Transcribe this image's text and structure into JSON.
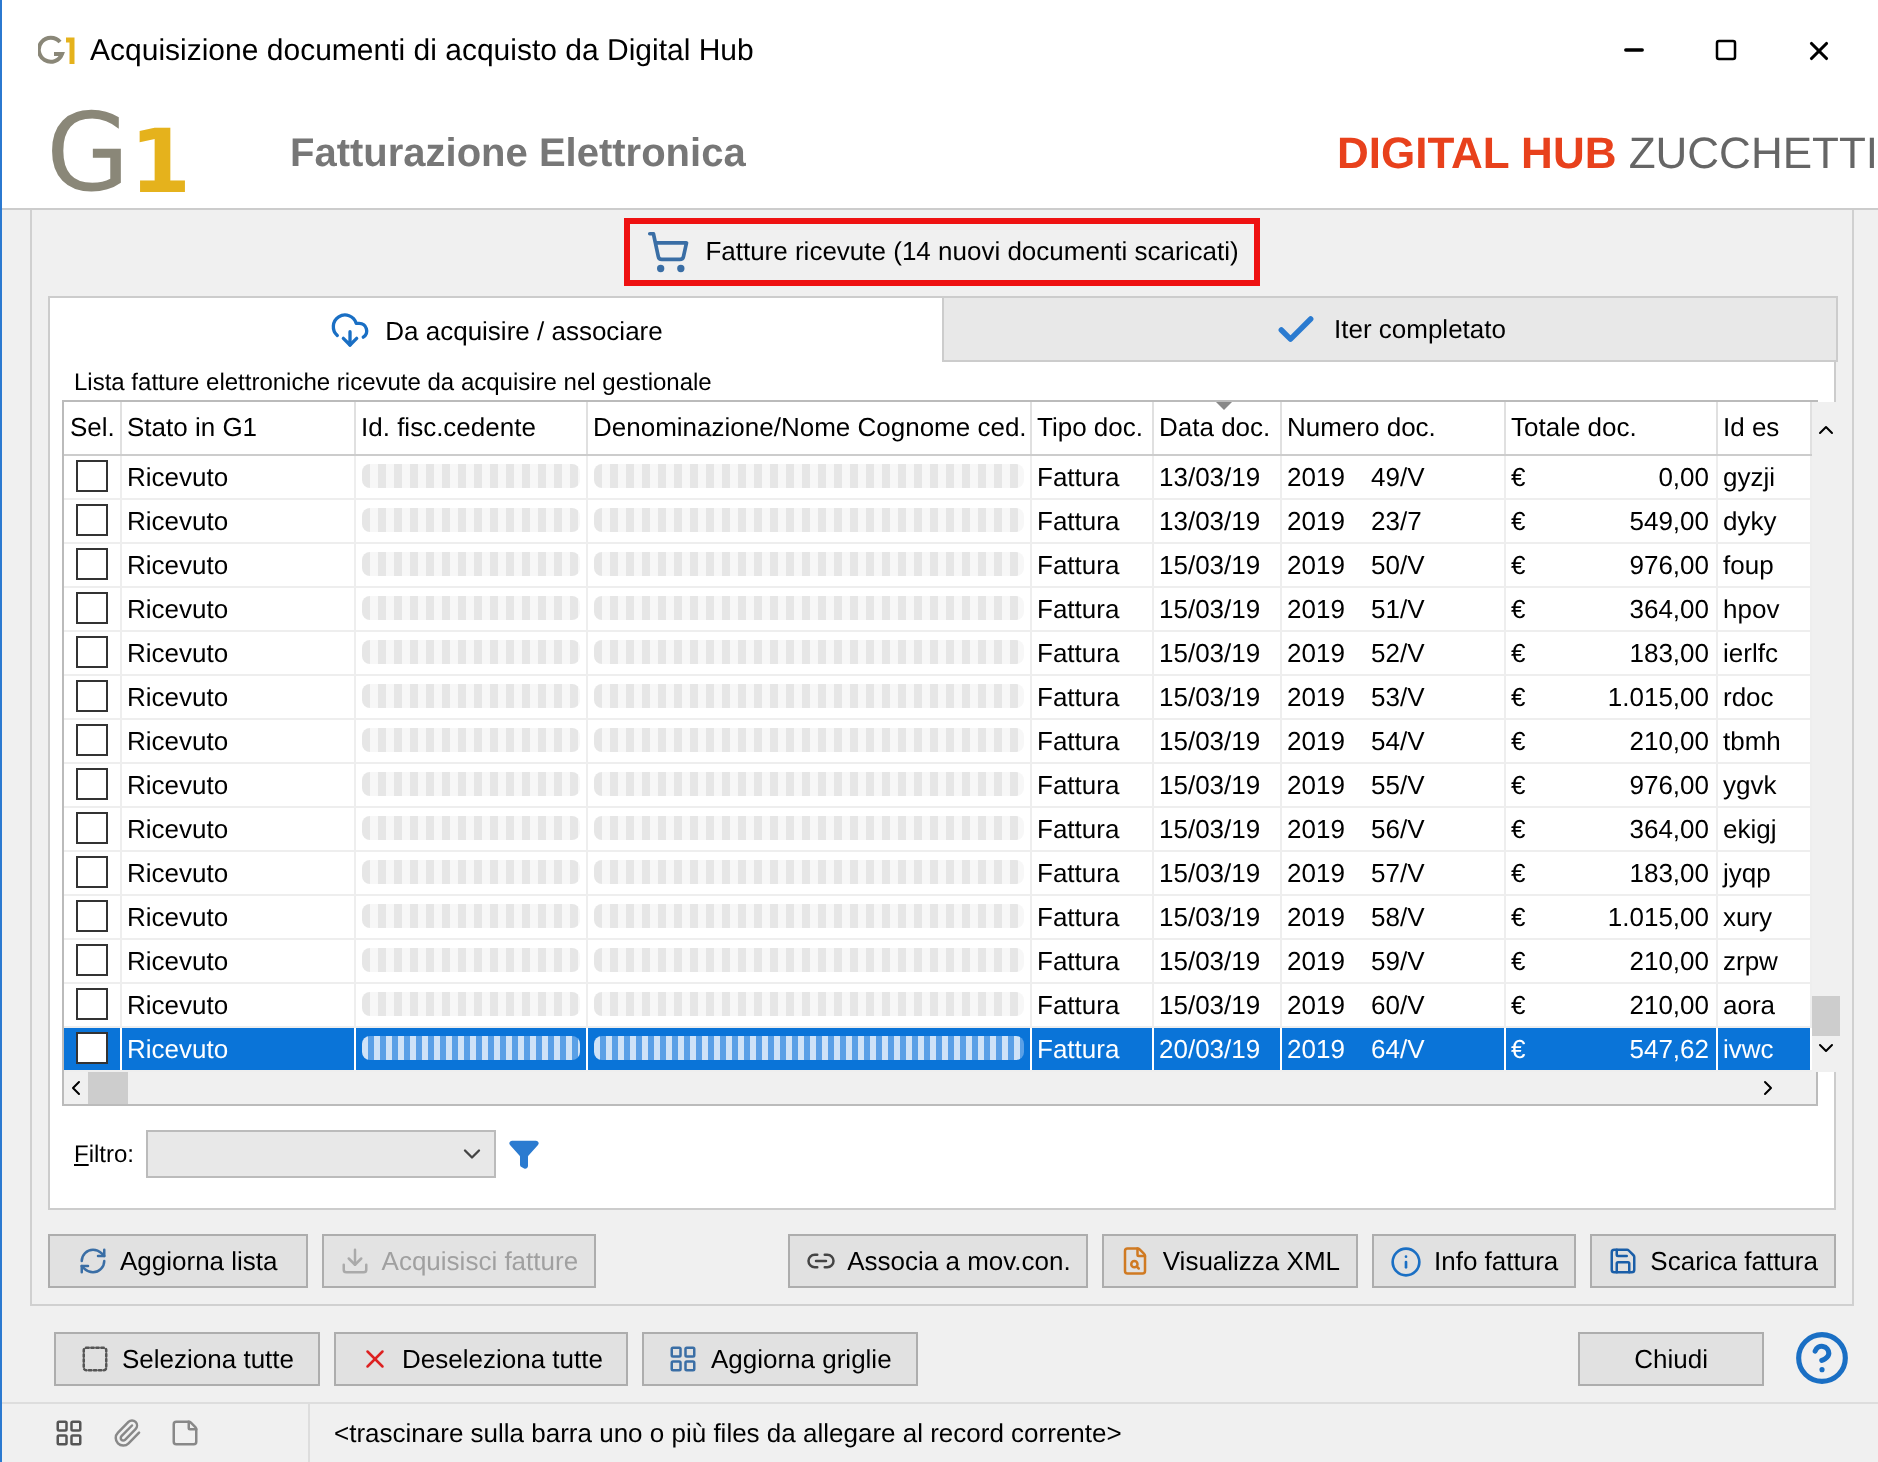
{
  "window": {
    "title": "Acquisizione documenti di acquisto da Digital Hub"
  },
  "header": {
    "logo_letter": "G",
    "logo_digit": "1",
    "app_title": "Fatturazione Elettronica",
    "brand_primary": "DIGITAL HUB",
    "brand_secondary": "ZUCCHETTI"
  },
  "received_button": {
    "label": "Fatture ricevute (14 nuovi documenti scaricati)",
    "highlighted": true
  },
  "tabs": [
    {
      "label": "Da acquisire / associare",
      "selected": true,
      "kind": "download"
    },
    {
      "label": "Iter completato",
      "selected": false,
      "kind": "check"
    }
  ],
  "group_label": "Lista fatture elettroniche ricevute da acquisire nel gestionale",
  "table": {
    "columns": [
      {
        "label": "Sel.",
        "sorted": false
      },
      {
        "label": "Stato in G1",
        "sorted": false
      },
      {
        "label": "Id. fisc.cedente",
        "sorted": false
      },
      {
        "label": "Denominazione/Nome Cognome ced.",
        "sorted": false
      },
      {
        "label": "Tipo doc.",
        "sorted": false
      },
      {
        "label": "Data doc.",
        "sorted": true
      },
      {
        "label": "Numero doc.",
        "sorted": false
      },
      {
        "label": "Totale doc.",
        "sorted": false
      },
      {
        "label": "Id es",
        "sorted": false
      }
    ],
    "rows": [
      {
        "checked": false,
        "selected": false,
        "status": "Ricevuto",
        "type": "Fattura",
        "date": "13/03/19",
        "year": "2019",
        "number": "49/V",
        "currency": "€",
        "total": "0,00",
        "id_es": "gyzji"
      },
      {
        "checked": false,
        "selected": false,
        "status": "Ricevuto",
        "type": "Fattura",
        "date": "13/03/19",
        "year": "2019",
        "number": "23/7",
        "currency": "€",
        "total": "549,00",
        "id_es": "dyky"
      },
      {
        "checked": false,
        "selected": false,
        "status": "Ricevuto",
        "type": "Fattura",
        "date": "15/03/19",
        "year": "2019",
        "number": "50/V",
        "currency": "€",
        "total": "976,00",
        "id_es": "foup"
      },
      {
        "checked": false,
        "selected": false,
        "status": "Ricevuto",
        "type": "Fattura",
        "date": "15/03/19",
        "year": "2019",
        "number": "51/V",
        "currency": "€",
        "total": "364,00",
        "id_es": "hpov"
      },
      {
        "checked": false,
        "selected": false,
        "status": "Ricevuto",
        "type": "Fattura",
        "date": "15/03/19",
        "year": "2019",
        "number": "52/V",
        "currency": "€",
        "total": "183,00",
        "id_es": "ierlfc"
      },
      {
        "checked": false,
        "selected": false,
        "status": "Ricevuto",
        "type": "Fattura",
        "date": "15/03/19",
        "year": "2019",
        "number": "53/V",
        "currency": "€",
        "total": "1.015,00",
        "id_es": "rdoc"
      },
      {
        "checked": false,
        "selected": false,
        "status": "Ricevuto",
        "type": "Fattura",
        "date": "15/03/19",
        "year": "2019",
        "number": "54/V",
        "currency": "€",
        "total": "210,00",
        "id_es": "tbmh"
      },
      {
        "checked": false,
        "selected": false,
        "status": "Ricevuto",
        "type": "Fattura",
        "date": "15/03/19",
        "year": "2019",
        "number": "55/V",
        "currency": "€",
        "total": "976,00",
        "id_es": "ygvk"
      },
      {
        "checked": false,
        "selected": false,
        "status": "Ricevuto",
        "type": "Fattura",
        "date": "15/03/19",
        "year": "2019",
        "number": "56/V",
        "currency": "€",
        "total": "364,00",
        "id_es": "ekigj"
      },
      {
        "checked": false,
        "selected": false,
        "status": "Ricevuto",
        "type": "Fattura",
        "date": "15/03/19",
        "year": "2019",
        "number": "57/V",
        "currency": "€",
        "total": "183,00",
        "id_es": "jyqp"
      },
      {
        "checked": false,
        "selected": false,
        "status": "Ricevuto",
        "type": "Fattura",
        "date": "15/03/19",
        "year": "2019",
        "number": "58/V",
        "currency": "€",
        "total": "1.015,00",
        "id_es": "xury"
      },
      {
        "checked": false,
        "selected": false,
        "status": "Ricevuto",
        "type": "Fattura",
        "date": "15/03/19",
        "year": "2019",
        "number": "59/V",
        "currency": "€",
        "total": "210,00",
        "id_es": "zrpw"
      },
      {
        "checked": false,
        "selected": false,
        "status": "Ricevuto",
        "type": "Fattura",
        "date": "15/03/19",
        "year": "2019",
        "number": "60/V",
        "currency": "€",
        "total": "210,00",
        "id_es": "aora"
      },
      {
        "checked": false,
        "selected": true,
        "status": "Ricevuto",
        "type": "Fattura",
        "date": "20/03/19",
        "year": "2019",
        "number": "64/V",
        "currency": "€",
        "total": "547,62",
        "id_es": "ivwc"
      }
    ]
  },
  "filter": {
    "label": "Filtro:"
  },
  "actions": [
    {
      "label": "Aggiorna lista",
      "kind": "refresh",
      "disabled": false
    },
    {
      "label": "Acquisisci fatture",
      "kind": "import",
      "disabled": true
    },
    {
      "label": "Associa a mov.con.",
      "kind": "link",
      "disabled": false
    },
    {
      "label": "Visualizza XML",
      "kind": "xml",
      "disabled": false
    },
    {
      "label": "Info fattura",
      "kind": "info",
      "disabled": false
    },
    {
      "label": "Scarica fattura",
      "kind": "save",
      "disabled": false
    }
  ],
  "footer_buttons": [
    {
      "label": "Seleziona tutte",
      "kind": "select"
    },
    {
      "label": "Deseleziona tutte",
      "kind": "deselect"
    },
    {
      "label": "Aggiorna griglie",
      "kind": "grid"
    }
  ],
  "close_button": "Chiudi",
  "status_bar": "<trascinare sulla barra uno o più files da allegare al record corrente>"
}
